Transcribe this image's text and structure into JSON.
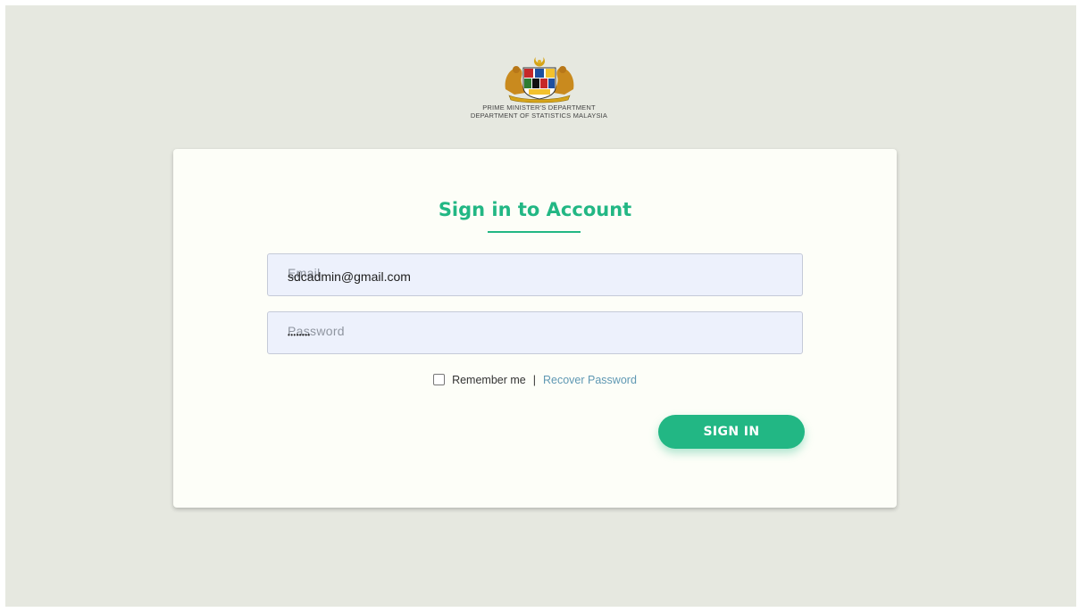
{
  "header": {
    "line1": "PRIME MINISTER'S DEPARTMENT",
    "line2": "DEPARTMENT OF STATISTICS MALAYSIA"
  },
  "form": {
    "title": "Sign in to Account",
    "email": {
      "placeholder": "Email",
      "value": "sdcadmin@gmail.com"
    },
    "password": {
      "placeholder": "Password",
      "masked": "••••••••"
    },
    "remember_label": "Remember me",
    "separator": "|",
    "recover_label": "Recover Password",
    "submit_label": "SIGN IN"
  },
  "colors": {
    "accent": "#22b784",
    "page_background": "#e6e8e0",
    "card_background": "#fdfef8",
    "input_background": "#edf1fc",
    "link": "#5f98b3"
  },
  "icons": {
    "logo": "malaysia-coat-of-arms-icon",
    "checkbox": "checkbox-unchecked-icon"
  }
}
